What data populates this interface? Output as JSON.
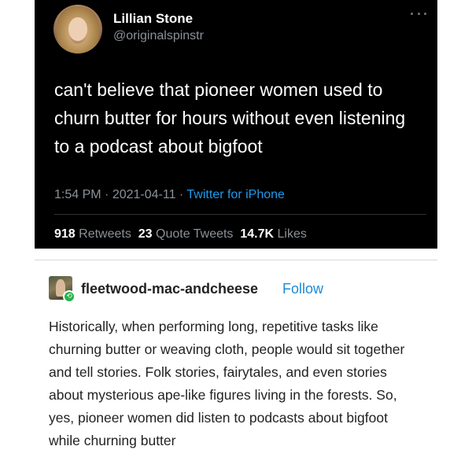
{
  "tweet": {
    "name": "Lillian Stone",
    "handle": "@originalspinstr",
    "more_icon": "ellipsis-icon",
    "text": "can't believe that pioneer women used to churn butter for hours without even listening to a podcast about bigfoot",
    "time": "1:54 PM",
    "date": "2021-04-11",
    "separator": " · ",
    "source": "Twitter for iPhone",
    "retweets_count": "918",
    "retweets_label": "Retweets",
    "quote_count": "23",
    "quote_label": "Quote Tweets",
    "likes_count": "14.7K",
    "likes_label": "Likes",
    "colors": {
      "background": "#000000",
      "link": "#1d9bf0",
      "muted": "#8b9198"
    }
  },
  "reply": {
    "username": "fleetwood-mac-andcheese",
    "follow_label": "Follow",
    "reblog_icon": "reblog-icon",
    "text": "Historically, when performing long, repetitive tasks like churning butter or weaving cloth, people would sit together and tell stories. Folk stories, fairytales, and even stories about mysterious ape-like figures living in the forests. So, yes, pioneer women did listen to podcasts about bigfoot while churning butter",
    "colors": {
      "follow": "#1e8ad6",
      "reblog": "#26b24b"
    }
  }
}
